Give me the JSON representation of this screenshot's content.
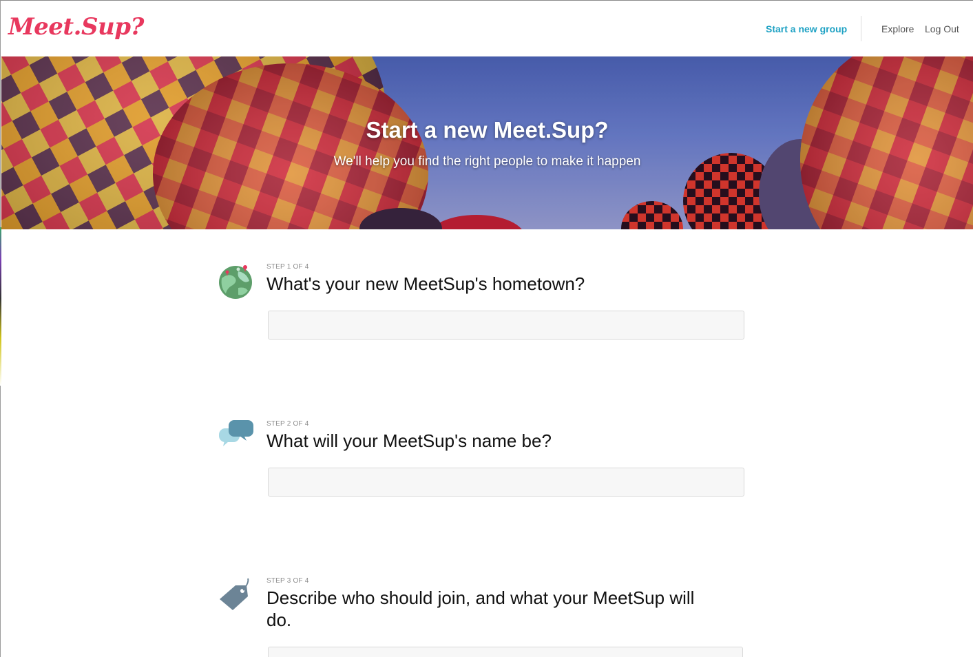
{
  "header": {
    "logo_text": "Meet.Sup?",
    "nav": {
      "start_group": "Start a new group",
      "explore": "Explore",
      "logout": "Log Out"
    }
  },
  "hero": {
    "title": "Start a new Meet.Sup?",
    "subtitle": "We'll help you find the right people to make it happen"
  },
  "steps": [
    {
      "label": "STEP 1 OF 4",
      "question": "What's your new MeetSup's hometown?",
      "icon": "globe-icon",
      "input_value": ""
    },
    {
      "label": "STEP 2 OF 4",
      "question": "What will your MeetSup's name be?",
      "icon": "chat-bubbles-icon",
      "input_value": ""
    },
    {
      "label": "STEP 3 OF 4",
      "question": "Describe who should join, and what your MeetSup will do.",
      "icon": "tag-icon",
      "input_value": ""
    }
  ],
  "colors": {
    "brand": "#e8385e",
    "link_accent": "#1fa2c4",
    "nav_text": "#555555",
    "input_bg": "#f7f7f7"
  }
}
